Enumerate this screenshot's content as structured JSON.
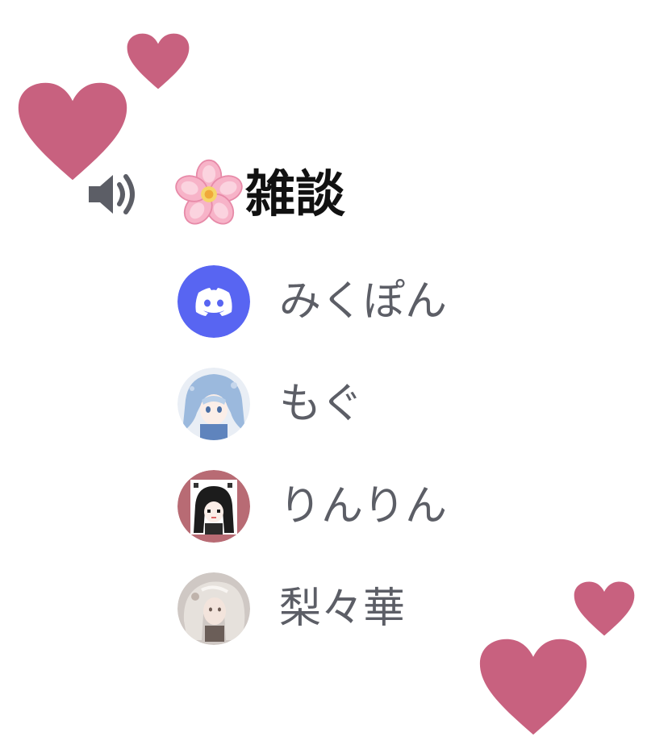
{
  "channel": {
    "icon": "speaker-icon",
    "emoji": "cherry-blossom",
    "name": "雑談"
  },
  "members": [
    {
      "name": "みくぽん",
      "avatar": "discord-default-avatar",
      "avatar_color": "#5865f2"
    },
    {
      "name": "もぐ",
      "avatar": "anime-avatar-blue-hair"
    },
    {
      "name": "りんりん",
      "avatar": "anime-avatar-black-hair",
      "avatar_color": "#b86b74"
    },
    {
      "name": "梨々華",
      "avatar": "portrait-avatar-silver-hair"
    }
  ],
  "decorations": {
    "heart_color": "#c8617f"
  }
}
